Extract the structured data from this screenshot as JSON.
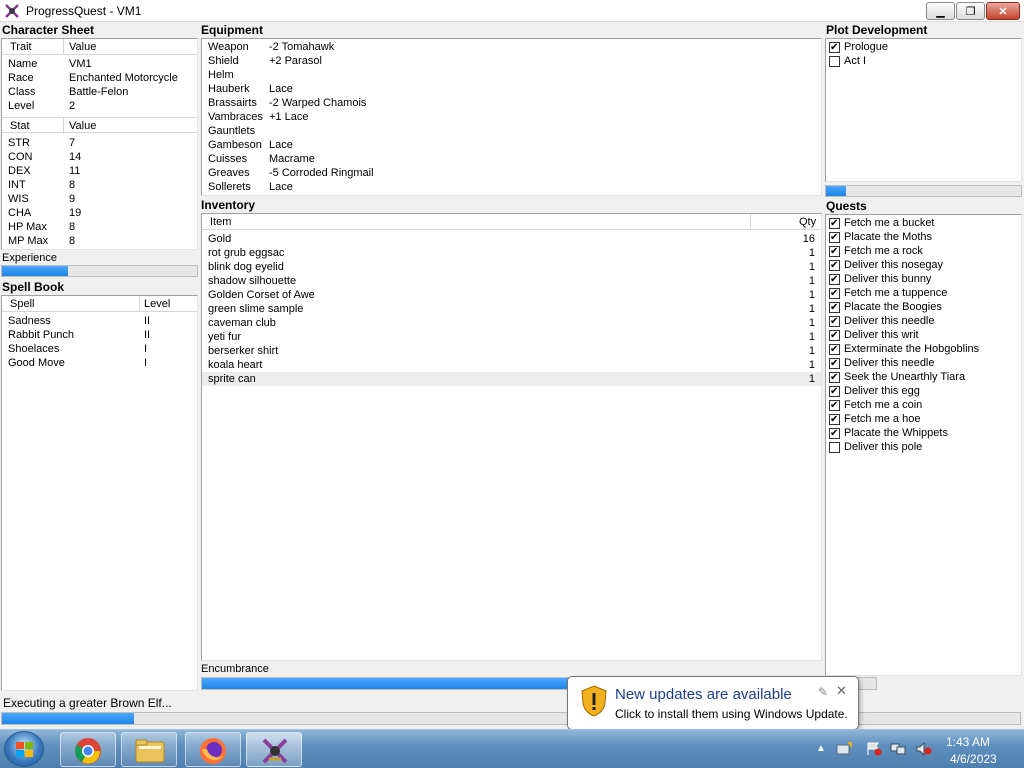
{
  "window": {
    "title": "ProgressQuest - VM1",
    "buttons": {
      "minimize": "▁",
      "maximize": "❐",
      "close": "✕"
    }
  },
  "character_sheet": {
    "title": "Character Sheet",
    "trait_header": [
      "Trait",
      "Value"
    ],
    "traits": [
      {
        "k": "Name",
        "v": "VM1"
      },
      {
        "k": "Race",
        "v": "Enchanted Motorcycle"
      },
      {
        "k": "Class",
        "v": "Battle-Felon"
      },
      {
        "k": "Level",
        "v": "2"
      }
    ],
    "stat_header": [
      "Stat",
      "Value"
    ],
    "stats": [
      {
        "k": "STR",
        "v": "7"
      },
      {
        "k": "CON",
        "v": "14"
      },
      {
        "k": "DEX",
        "v": "11"
      },
      {
        "k": "INT",
        "v": "8"
      },
      {
        "k": "WIS",
        "v": "9"
      },
      {
        "k": "CHA",
        "v": "19"
      },
      {
        "k": "HP Max",
        "v": "8"
      },
      {
        "k": "MP Max",
        "v": "8"
      }
    ],
    "experience_label": "Experience",
    "experience_progress": 0.34
  },
  "spell_book": {
    "title": "Spell Book",
    "header": [
      "Spell",
      "Level"
    ],
    "spells": [
      {
        "k": "Sadness",
        "v": "II"
      },
      {
        "k": "Rabbit Punch",
        "v": "II"
      },
      {
        "k": "Shoelaces",
        "v": "I"
      },
      {
        "k": "Good Move",
        "v": "I"
      }
    ]
  },
  "equipment": {
    "title": "Equipment",
    "items": [
      {
        "k": "Weapon",
        "v": "-2 Tomahawk"
      },
      {
        "k": "Shield",
        "v": "+2 Parasol"
      },
      {
        "k": "Helm",
        "v": ""
      },
      {
        "k": "Hauberk",
        "v": "Lace"
      },
      {
        "k": "Brassairts",
        "v": "-2 Warped Chamois"
      },
      {
        "k": "Vambraces",
        "v": "+1 Lace"
      },
      {
        "k": "Gauntlets",
        "v": ""
      },
      {
        "k": "Gambeson",
        "v": "Lace"
      },
      {
        "k": "Cuisses",
        "v": "Macrame"
      },
      {
        "k": "Greaves",
        "v": "-5 Corroded Ringmail"
      },
      {
        "k": "Sollerets",
        "v": "Lace"
      }
    ]
  },
  "inventory": {
    "title": "Inventory",
    "header": [
      "Item",
      "Qty"
    ],
    "items": [
      {
        "k": "Gold",
        "v": "16"
      },
      {
        "k": "rot grub eggsac",
        "v": "1"
      },
      {
        "k": "blink dog eyelid",
        "v": "1"
      },
      {
        "k": "shadow silhouette",
        "v": "1"
      },
      {
        "k": "Golden Corset of Awe",
        "v": "1"
      },
      {
        "k": "green slime sample",
        "v": "1"
      },
      {
        "k": "caveman club",
        "v": "1"
      },
      {
        "k": "yeti fur",
        "v": "1"
      },
      {
        "k": "berserker shirt",
        "v": "1"
      },
      {
        "k": "koala heart",
        "v": "1"
      },
      {
        "k": "sprite can",
        "v": "1"
      }
    ],
    "encumbrance_label": "Encumbrance",
    "encumbrance_progress": 0.82
  },
  "plot": {
    "title": "Plot Development",
    "acts": [
      {
        "label": "Prologue",
        "checked": true
      },
      {
        "label": "Act I",
        "checked": false
      }
    ],
    "progress": 0.1
  },
  "quests": {
    "title": "Quests",
    "items": [
      {
        "label": "Fetch me a bucket",
        "checked": true
      },
      {
        "label": "Placate the Moths",
        "checked": true
      },
      {
        "label": "Fetch me a rock",
        "checked": true
      },
      {
        "label": "Deliver this nosegay",
        "checked": true
      },
      {
        "label": "Deliver this bunny",
        "checked": true
      },
      {
        "label": "Fetch me a tuppence",
        "checked": true
      },
      {
        "label": "Placate the Boogies",
        "checked": true
      },
      {
        "label": "Deliver this needle",
        "checked": true
      },
      {
        "label": "Deliver this writ",
        "checked": true
      },
      {
        "label": "Exterminate the Hobgoblins",
        "checked": true
      },
      {
        "label": "Deliver this needle",
        "checked": true
      },
      {
        "label": "Seek the Unearthly Tiara",
        "checked": true
      },
      {
        "label": "Deliver this egg",
        "checked": true
      },
      {
        "label": "Fetch me a coin",
        "checked": true
      },
      {
        "label": "Fetch me a hoe",
        "checked": true
      },
      {
        "label": "Placate the Whippets",
        "checked": true
      },
      {
        "label": "Deliver this pole",
        "checked": false
      }
    ]
  },
  "status": {
    "text": "Executing a greater Brown Elf...",
    "progress": 0.13
  },
  "notification": {
    "title": "New updates are available",
    "body": "Click to install them using Windows Update."
  },
  "taskbar": {
    "time": "1:43 AM",
    "date": "4/6/2023",
    "apps": [
      "chrome-icon",
      "file-explorer-icon",
      "firefox-icon",
      "progressquest-icon"
    ]
  },
  "colors": {
    "progress": "#1f86e8",
    "taskbar": "#5f8fbd",
    "balloon_title": "#1e3e8c"
  }
}
